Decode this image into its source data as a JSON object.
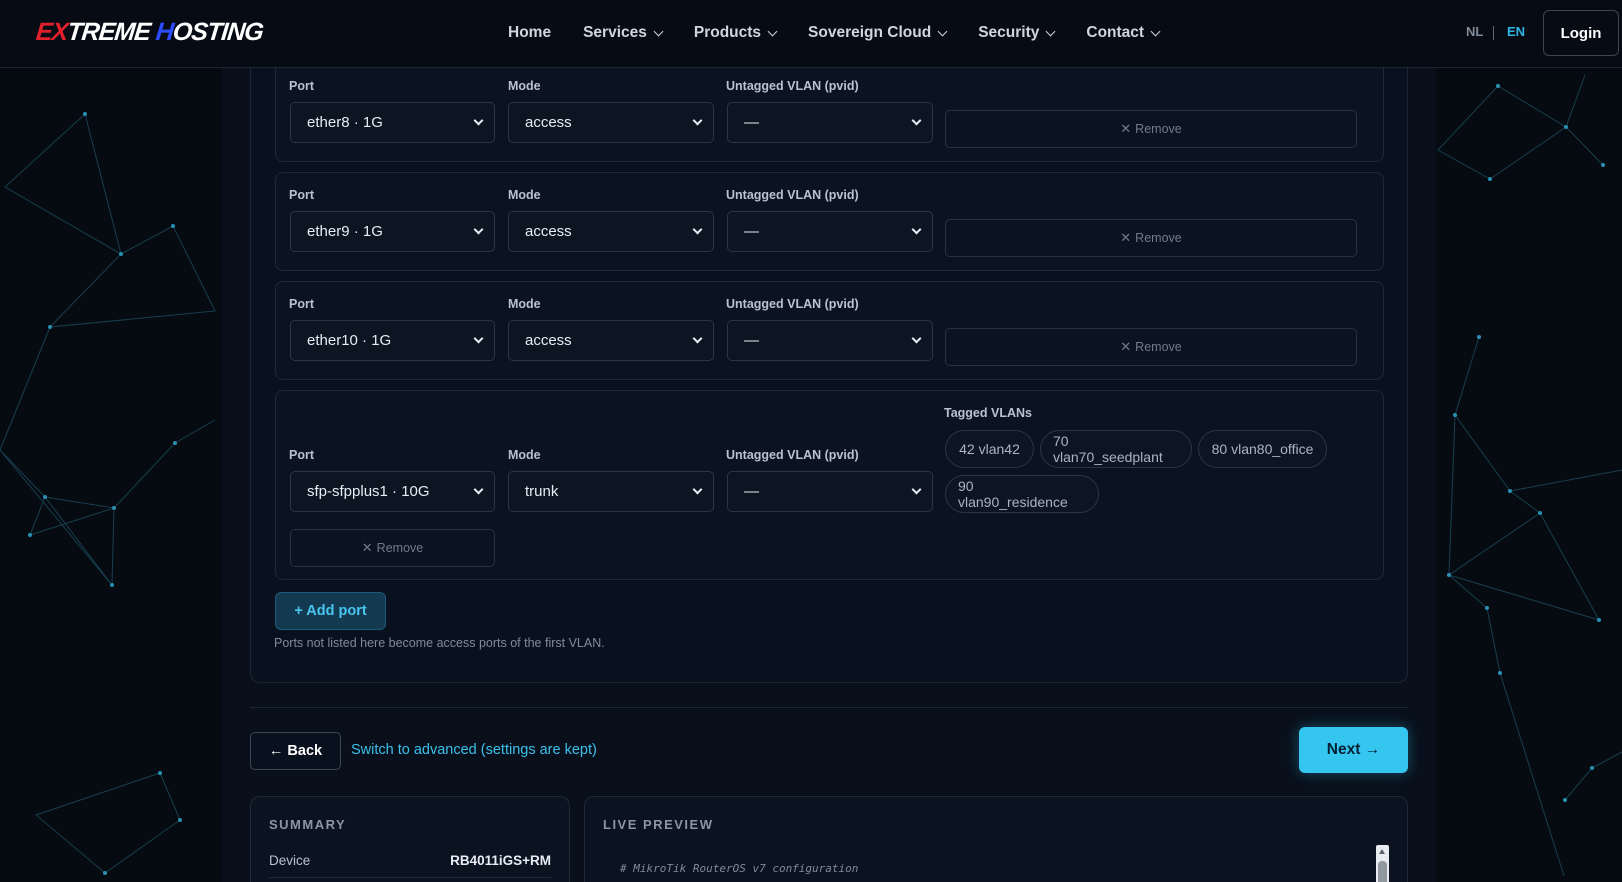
{
  "brand": {
    "logo_parts": [
      "E",
      "X",
      "TREME ",
      "H",
      "OSTING"
    ]
  },
  "nav": {
    "items": [
      {
        "label": "Home",
        "has_dropdown": false
      },
      {
        "label": "Services",
        "has_dropdown": true
      },
      {
        "label": "Products",
        "has_dropdown": true
      },
      {
        "label": "Sovereign Cloud",
        "has_dropdown": true
      },
      {
        "label": "Security",
        "has_dropdown": true
      },
      {
        "label": "Contact",
        "has_dropdown": true
      }
    ],
    "lang_nl": "NL",
    "lang_en": "EN",
    "login": "Login"
  },
  "ports": {
    "labels": {
      "port": "Port",
      "mode": "Mode",
      "untagged": "Untagged VLAN (pvid)",
      "tagged": "Tagged VLANs",
      "remove": "Remove"
    },
    "rows": [
      {
        "port": "ether8 · 1G",
        "mode": "access",
        "pvid": "—"
      },
      {
        "port": "ether9 · 1G",
        "mode": "access",
        "pvid": "—"
      },
      {
        "port": "ether10 · 1G",
        "mode": "access",
        "pvid": "—"
      },
      {
        "port": "sfp-sfpplus1 · 10G",
        "mode": "trunk",
        "pvid": "—",
        "tagged": [
          "42 vlan42",
          "70 vlan70_seedplant",
          "80 vlan80_office",
          "90 vlan90_residence"
        ]
      }
    ],
    "add_port": "+ Add port",
    "hint": "Ports not listed here become access ports of the first VLAN."
  },
  "actions": {
    "back": "← Back",
    "switch_advanced": "Switch to advanced (settings are kept)",
    "next": "Next →"
  },
  "summary": {
    "title": "SUMMARY",
    "device_label": "Device",
    "device_value": "RB4011iGS+RM"
  },
  "preview": {
    "title": "LIVE PREVIEW",
    "first_line": "# MikroTik RouterOS v7 configuration"
  },
  "colors": {
    "accent": "#34c6ee",
    "background": "#060b12",
    "panel": "#0b1220"
  }
}
